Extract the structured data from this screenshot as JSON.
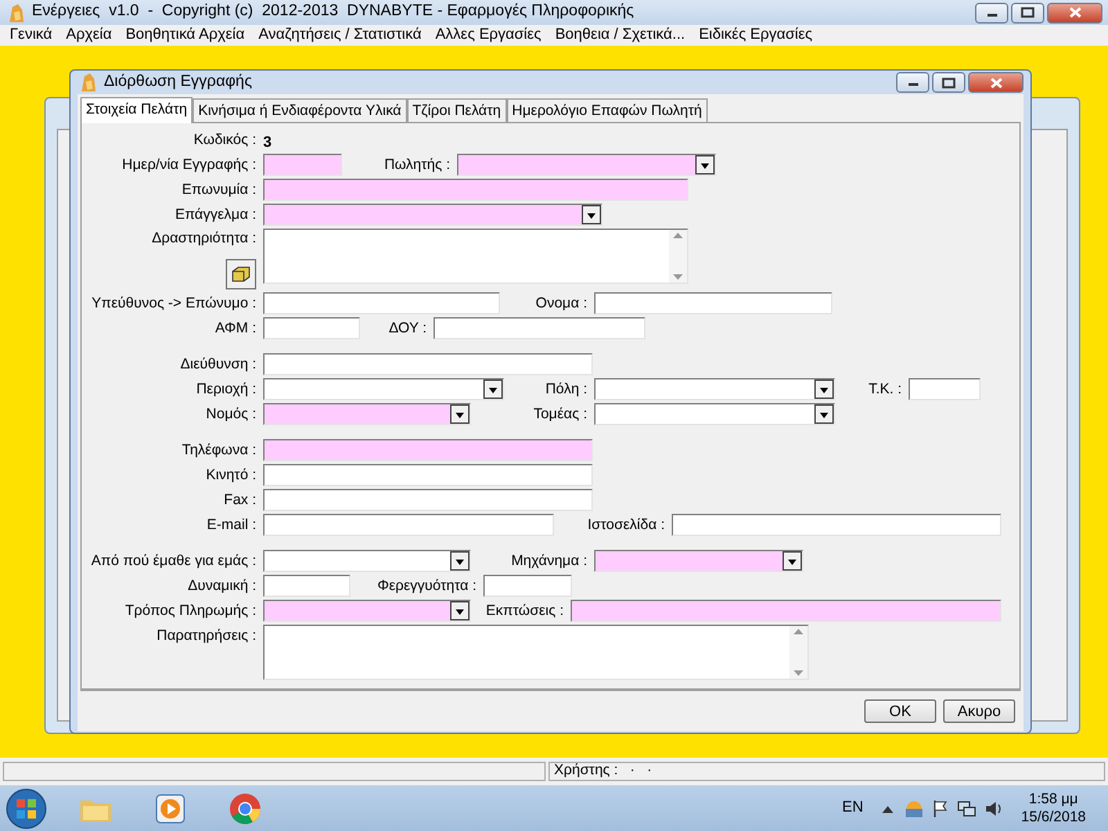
{
  "window": {
    "title": "Ενέργειες  v1.0  -  Copyright (c)  2012-2013  DYNABYTE - Εφαρμογές Πληροφορικής"
  },
  "menu": [
    "Γενικά",
    "Αρχεία",
    "Βοηθητικά Αρχεία",
    "Αναζητήσεις / Στατιστικά",
    "Αλλες Εργασίες",
    "Βοηθεια / Σχετικά...",
    "Ειδικές Εργασίες"
  ],
  "dialog": {
    "title": "Διόρθωση Εγγραφής",
    "tabs": [
      {
        "label": "Στοιχεία Πελάτη",
        "selected": true
      },
      {
        "label": "Κινήσιμα ή Ενδιαφέροντα Υλικά",
        "selected": false
      },
      {
        "label": "Τζίροι Πελάτη",
        "selected": false
      },
      {
        "label": "Ημερολόγιο Επαφών Πωλητή",
        "selected": false
      }
    ],
    "rows": [
      {
        "fields": [
          {
            "label": "Κωδικός :",
            "kind": "static",
            "value": "3"
          }
        ]
      },
      {
        "fields": [
          {
            "label": "Ημερ/νία Εγγραφής :",
            "kind": "text",
            "highlighted": true
          },
          {
            "label": "Πωλητής :",
            "kind": "combo",
            "highlighted": true
          }
        ]
      },
      {
        "fields": [
          {
            "label": "Επωνυμία :",
            "kind": "text",
            "highlighted": true
          }
        ]
      },
      {
        "fields": [
          {
            "label": "Επάγγελμα :",
            "kind": "combo",
            "highlighted": true
          }
        ]
      },
      {
        "fields": [
          {
            "label": "Δραστηριότητα :",
            "kind": "memo",
            "highlighted": false,
            "browse_button": true
          }
        ]
      },
      {
        "fields": [
          {
            "label": "Υπεύθυνος -> Επώνυμο :",
            "kind": "text",
            "highlighted": false
          },
          {
            "label": "Ονομα :",
            "kind": "text",
            "highlighted": false
          }
        ]
      },
      {
        "fields": [
          {
            "label": "ΑΦΜ :",
            "kind": "text",
            "highlighted": false
          },
          {
            "label": "ΔΟΥ :",
            "kind": "text",
            "highlighted": false
          }
        ]
      },
      {
        "fields": [
          {
            "label": "Διεύθυνση :",
            "kind": "text",
            "highlighted": false
          }
        ]
      },
      {
        "fields": [
          {
            "label": "Περιοχή :",
            "kind": "combo",
            "highlighted": false
          },
          {
            "label": "Πόλη :",
            "kind": "combo",
            "highlighted": false
          },
          {
            "label": "Τ.Κ. :",
            "kind": "text",
            "highlighted": false
          }
        ]
      },
      {
        "fields": [
          {
            "label": "Νομός :",
            "kind": "combo",
            "highlighted": true
          },
          {
            "label": "Τομέας :",
            "kind": "combo",
            "highlighted": false
          }
        ]
      },
      {
        "fields": [
          {
            "label": "Τηλέφωνα :",
            "kind": "text",
            "highlighted": true
          }
        ]
      },
      {
        "fields": [
          {
            "label": "Κινητό :",
            "kind": "text",
            "highlighted": false
          }
        ]
      },
      {
        "fields": [
          {
            "label": "Fax :",
            "kind": "text",
            "highlighted": false
          }
        ]
      },
      {
        "fields": [
          {
            "label": "E-mail :",
            "kind": "text",
            "highlighted": false
          },
          {
            "label": "Ιστοσελίδα :",
            "kind": "text",
            "highlighted": false
          }
        ]
      },
      {
        "fields": [
          {
            "label": "Από πού έμαθε για εμάς :",
            "kind": "combo",
            "highlighted": false
          },
          {
            "label": "Μηχάνημα :",
            "kind": "combo",
            "highlighted": true
          }
        ]
      },
      {
        "fields": [
          {
            "label": "Δυναμική :",
            "kind": "text",
            "highlighted": false
          },
          {
            "label": "Φερεγγυότητα :",
            "kind": "text",
            "highlighted": false
          }
        ]
      },
      {
        "fields": [
          {
            "label": "Τρόπος Πληρωμής :",
            "kind": "combo",
            "highlighted": true
          },
          {
            "label": "Εκπτώσεις :",
            "kind": "text",
            "highlighted": true
          }
        ]
      },
      {
        "fields": [
          {
            "label": "Παρατηρήσεις :",
            "kind": "memo",
            "highlighted": false
          }
        ]
      }
    ],
    "buttons": [
      "OK",
      "Ακυρο"
    ]
  },
  "status_bar": {
    "user": "Χρήστης :   ·   ·"
  },
  "taskbar": {
    "language": "EN",
    "time": "1:58 μμ",
    "date": "15/6/2018"
  }
}
